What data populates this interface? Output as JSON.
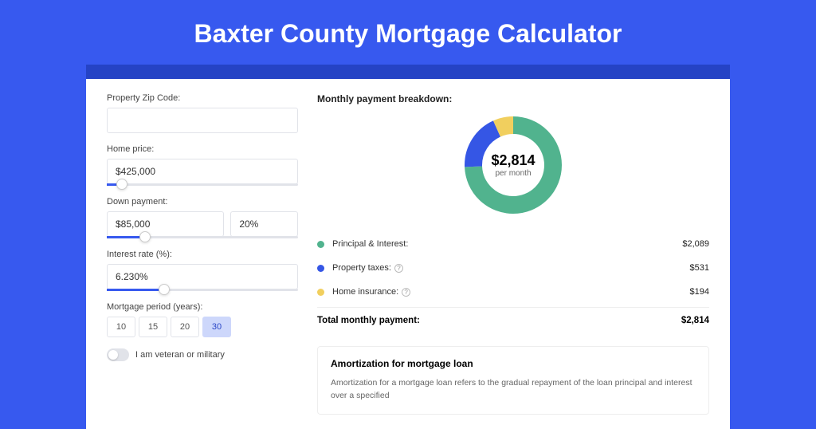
{
  "page": {
    "title": "Baxter County Mortgage Calculator"
  },
  "form": {
    "zip_label": "Property Zip Code:",
    "zip_value": "",
    "price_label": "Home price:",
    "price_value": "$425,000",
    "price_slider_pct": 8,
    "down_label": "Down payment:",
    "down_amount": "$85,000",
    "down_pct": "20%",
    "down_slider_pct": 20,
    "rate_label": "Interest rate (%):",
    "rate_value": "6.230%",
    "rate_slider_pct": 30,
    "period_label": "Mortgage period (years):",
    "periods": [
      "10",
      "15",
      "20",
      "30"
    ],
    "period_active_index": 3,
    "veteran_label": "I am veteran or military"
  },
  "breakdown": {
    "title": "Monthly payment breakdown:",
    "center_amount": "$2,814",
    "center_sub": "per month",
    "items": [
      {
        "label": "Principal & Interest:",
        "value": "$2,089",
        "color": "#51b38e",
        "info": false
      },
      {
        "label": "Property taxes:",
        "value": "$531",
        "color": "#3556e5",
        "info": true
      },
      {
        "label": "Home insurance:",
        "value": "$194",
        "color": "#f1cf5e",
        "info": true
      }
    ],
    "total_label": "Total monthly payment:",
    "total_value": "$2,814"
  },
  "amort": {
    "title": "Amortization for mortgage loan",
    "text": "Amortization for a mortgage loan refers to the gradual repayment of the loan principal and interest over a specified"
  },
  "chart_data": {
    "type": "pie",
    "title": "Monthly payment breakdown",
    "series": [
      {
        "name": "Principal & Interest",
        "value": 2089,
        "color": "#51b38e"
      },
      {
        "name": "Property taxes",
        "value": 531,
        "color": "#3556e5"
      },
      {
        "name": "Home insurance",
        "value": 194,
        "color": "#f1cf5e"
      }
    ],
    "total": 2814,
    "center_label": "$2,814 per month"
  }
}
